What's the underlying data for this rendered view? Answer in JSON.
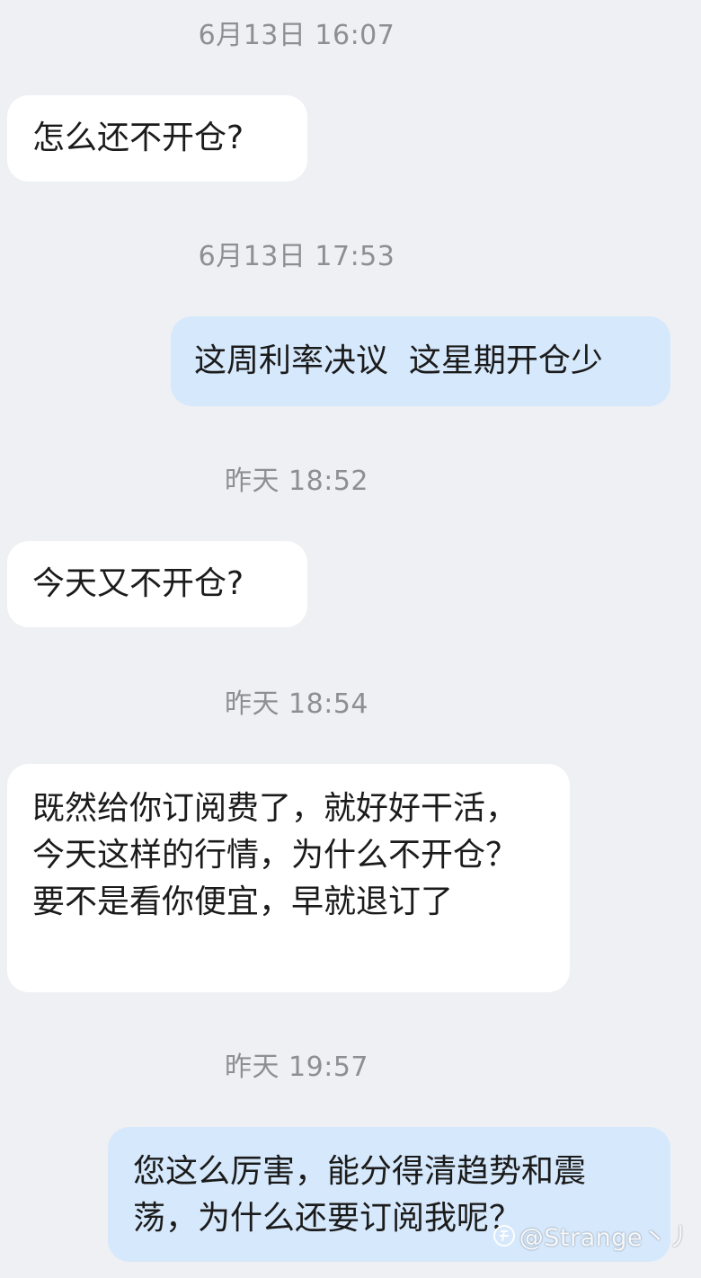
{
  "messages": [
    {
      "time": "6月13日 16:07",
      "direction": "in",
      "text": "怎么还不开仓?"
    },
    {
      "time": "6月13日 17:53",
      "direction": "out",
      "text": "这周利率决议  这星期开仓少"
    },
    {
      "time": "昨天 18:52",
      "direction": "in",
      "text": "今天又不开仓?"
    },
    {
      "time": "昨天 18:54",
      "direction": "in",
      "text": "既然给你订阅费了，就好好干活， 今天这样的行情，为什么不开仓？要不是看你便宜，早就退订了"
    },
    {
      "time": "昨天 19:57",
      "direction": "out",
      "text": "您这么厉害，能分得清趋势和震荡，为什么还要订阅我呢？"
    }
  ],
  "watermark": {
    "text": "@Strange丶丿",
    "icon": "zhihu-logo-icon"
  },
  "colors": {
    "background": "#eef0f4",
    "incoming_bubble": "#ffffff",
    "outgoing_bubble": "#d6e8fb",
    "timestamp": "#8d8f94",
    "message_text": "#1b1b1b"
  }
}
